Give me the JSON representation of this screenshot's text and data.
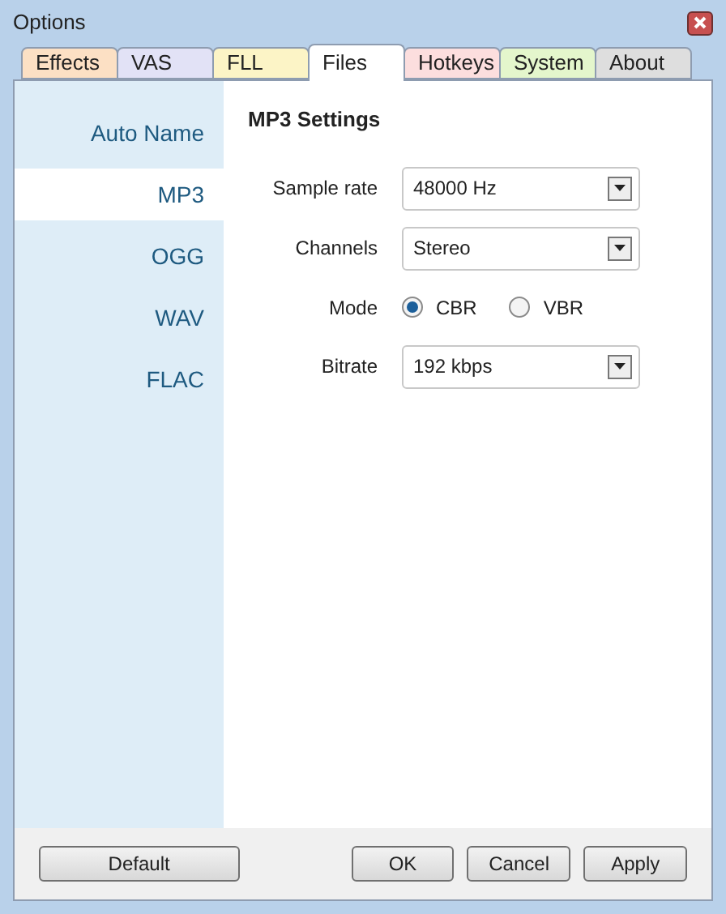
{
  "window": {
    "title": "Options"
  },
  "tabs": [
    {
      "label": "Effects",
      "selected": false,
      "color": "#fce0c4"
    },
    {
      "label": "VAS",
      "selected": false,
      "color": "#e2e2f6"
    },
    {
      "label": "FLL",
      "selected": false,
      "color": "#fcf4c6"
    },
    {
      "label": "Files",
      "selected": true,
      "color": "#ffffff"
    },
    {
      "label": "Hotkeys",
      "selected": false,
      "color": "#fcdede"
    },
    {
      "label": "System",
      "selected": false,
      "color": "#e4f6cc"
    },
    {
      "label": "About",
      "selected": false,
      "color": "#dedede"
    }
  ],
  "sidebar": {
    "items": [
      {
        "label": "Auto Name",
        "selected": false
      },
      {
        "label": "MP3",
        "selected": true
      },
      {
        "label": "OGG",
        "selected": false
      },
      {
        "label": "WAV",
        "selected": false
      },
      {
        "label": "FLAC",
        "selected": false
      }
    ]
  },
  "panel": {
    "title": "MP3 Settings",
    "rows": [
      {
        "kind": "select",
        "label": "Sample rate",
        "value": "48000 Hz"
      },
      {
        "kind": "select",
        "label": "Channels",
        "value": "Stereo"
      },
      {
        "kind": "radio",
        "label": "Mode",
        "options": [
          {
            "label": "CBR",
            "selected": true
          },
          {
            "label": "VBR",
            "selected": false
          }
        ]
      },
      {
        "kind": "select",
        "label": "Bitrate",
        "value": "192 kbps"
      }
    ]
  },
  "buttons": [
    "Default",
    "OK",
    "Cancel",
    "Apply"
  ]
}
